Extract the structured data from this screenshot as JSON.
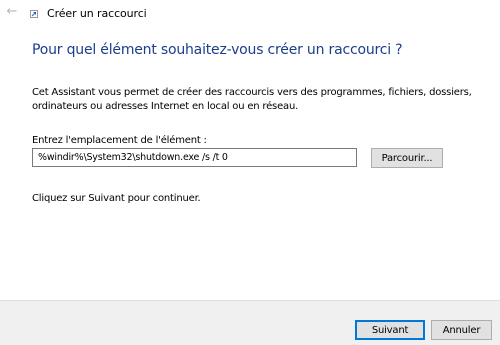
{
  "window": {
    "title": "Créer un raccourci",
    "back_icon": "arrow-left-icon",
    "app_icon": "shortcut-icon"
  },
  "main": {
    "heading": "Pour quel élément souhaitez-vous créer un raccourci ?",
    "description": "Cet Assistant vous permet de créer des raccourcis vers des programmes, fichiers, dossiers, ordinateurs ou adresses Internet en local ou en réseau.",
    "location_label": "Entrez l'emplacement de l'élément :",
    "location_value": "%windir%\\System32\\shutdown.exe /s /t 0",
    "browse_label": "Parcourir...",
    "hint": "Cliquez sur Suivant pour continuer."
  },
  "footer": {
    "next_label": "Suivant",
    "cancel_label": "Annuler"
  },
  "colors": {
    "heading": "#1a3e8c",
    "default_button_border": "#0078d7",
    "footer_background": "#f0f0f0"
  }
}
